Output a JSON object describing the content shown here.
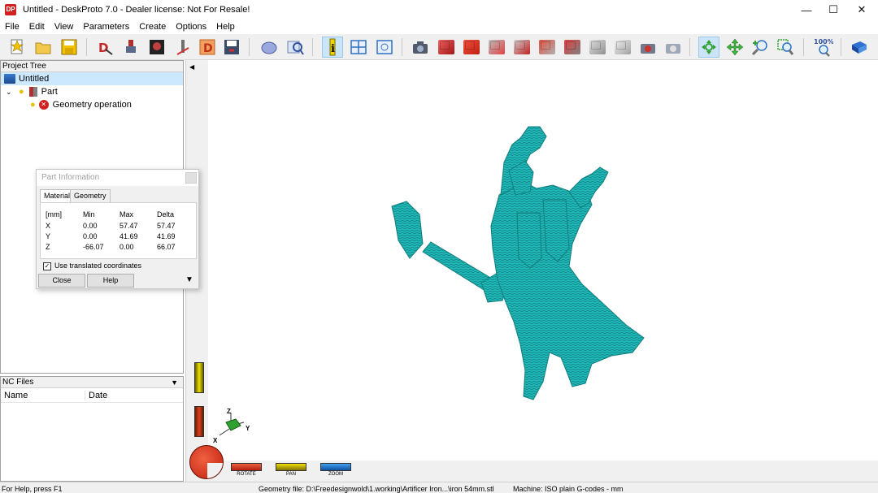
{
  "window": {
    "app_icon_text": "DP",
    "title": "Untitled - DeskProto 7.0 - Dealer license: Not For Resale!",
    "minimize": "—",
    "maximize": "☐",
    "close": "✕"
  },
  "menu": [
    "File",
    "Edit",
    "View",
    "Parameters",
    "Create",
    "Options",
    "Help"
  ],
  "toolbar": {
    "zoom_percent": "100%"
  },
  "project_tree": {
    "header": "Project Tree",
    "root": "Untitled",
    "part": "Part",
    "operation": "Geometry operation"
  },
  "nc_files": {
    "header": "NC Files",
    "col_name": "Name",
    "col_date": "Date"
  },
  "part_info": {
    "title": "Part Information",
    "tabs": [
      "Material",
      "Geometry"
    ],
    "headers": [
      "[mm]",
      "Min",
      "Max",
      "Delta"
    ],
    "rows": [
      [
        "X",
        "0.00",
        "57.47",
        "57.47"
      ],
      [
        "Y",
        "0.00",
        "41.69",
        "41.69"
      ],
      [
        "Z",
        "-66.07",
        "0.00",
        "66.07"
      ]
    ],
    "checkbox_label": "Use translated coordinates",
    "checkbox_checked": true,
    "close_button": "Close",
    "help_button": "Help"
  },
  "axes": {
    "x": "X",
    "y": "Y",
    "z": "Z"
  },
  "view_controls": {
    "rotate": "ROTATE",
    "pan": "PAN",
    "zoom": "ZOOM"
  },
  "status": {
    "help": "For Help, press F1",
    "geometry": "Geometry file: D:\\Freedesignwold\\1.working\\Artificer Iron...\\iron 54mm.stl",
    "machine": "Machine: ISO plain G-codes - mm"
  },
  "colors": {
    "model": "#1fb8b8",
    "model_dark": "#127d7d",
    "accent_select": "#cce8ff",
    "rotate": "#d8301a",
    "pan": "#e0c000",
    "zoom": "#2080e0"
  }
}
